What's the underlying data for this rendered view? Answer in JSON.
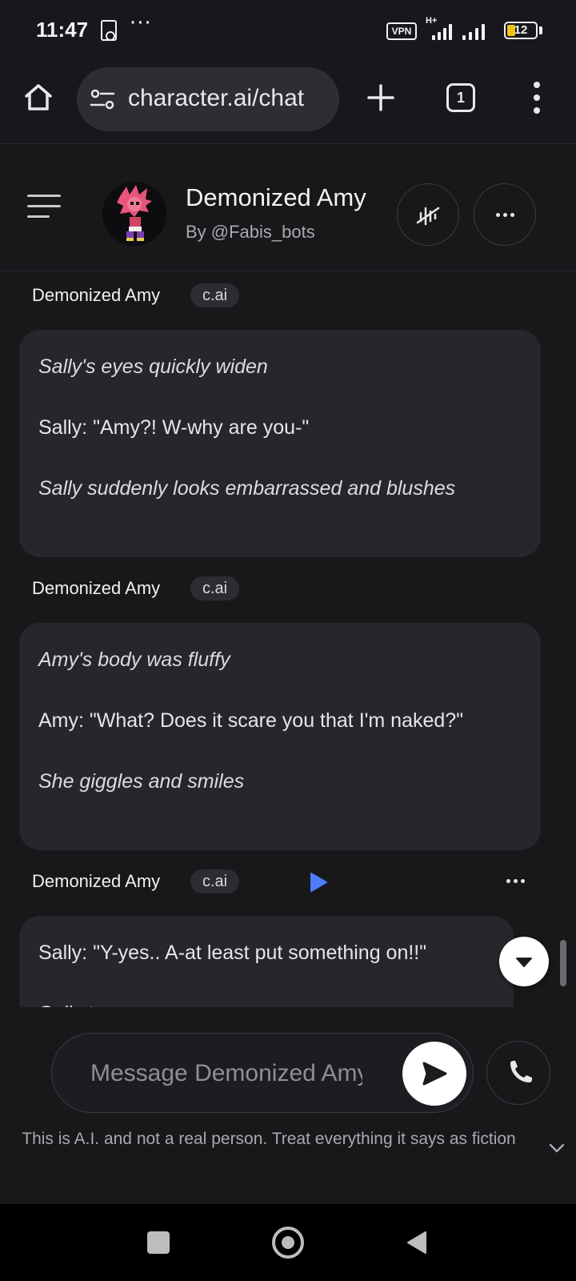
{
  "status_bar": {
    "time": "11:47",
    "overflow": "···",
    "vpn": "VPN",
    "network_type": "H+",
    "battery": "12"
  },
  "browser": {
    "url": "character.ai/chat",
    "tab_count": "1"
  },
  "chat_header": {
    "character_name": "Demonized Amy",
    "author": "By @Fabis_bots"
  },
  "messages": [
    {
      "author": "Demonized Amy",
      "badge": "c.ai",
      "paragraphs": [
        {
          "text": "Sally's eyes quickly widen",
          "italic": true
        },
        {
          "text": "Sally: \"Amy?! W-why are you-\"",
          "italic": false
        },
        {
          "text": "Sally suddenly looks embarrassed and blushes",
          "italic": true
        }
      ]
    },
    {
      "author": "Demonized Amy",
      "badge": "c.ai",
      "paragraphs": [
        {
          "text": "Amy's body was fluffy",
          "italic": true
        },
        {
          "text": "Amy: \"What? Does it scare you that I'm naked?\"",
          "italic": false
        },
        {
          "text": "She giggles and smiles",
          "italic": true
        }
      ]
    },
    {
      "author": "Demonized Amy",
      "badge": "c.ai",
      "paragraphs": [
        {
          "text": "Sally: \"Y-yes.. A-at least put something on!!\"",
          "italic": false
        },
        {
          "text": "Sally tur",
          "italic": true
        }
      ]
    }
  ],
  "composer": {
    "placeholder": "Message Demonized Amy"
  },
  "disclaimer": "This is A.I. and not a real person. Treat everything it says as fiction",
  "colors": {
    "background": "#18181b",
    "bubble": "#26272b",
    "badge": "#2c2d32",
    "play_accent": "#4f7cff"
  },
  "icons": [
    "home-icon",
    "site-settings-icon",
    "plus-icon",
    "tab-switcher-icon",
    "kebab-menu-icon",
    "hamburger-icon",
    "mute-voice-icon",
    "more-icon",
    "play-icon",
    "chevron-down-icon",
    "send-icon",
    "phone-icon"
  ]
}
